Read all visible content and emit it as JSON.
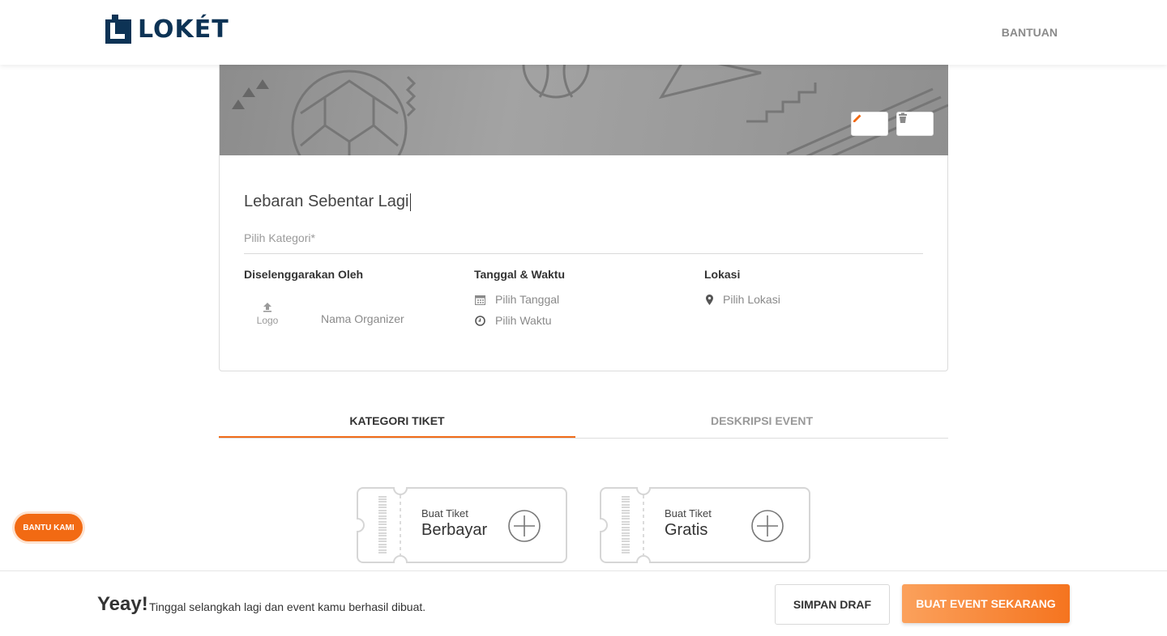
{
  "header": {
    "brand": "LOKÉT",
    "help_label": "BANTUAN"
  },
  "event": {
    "title": "Lebaran Sebentar Lagi",
    "category_placeholder": "Pilih Kategori*",
    "organizer": {
      "label": "Diselenggarakan Oleh",
      "logo_label": "Logo",
      "name_placeholder": "Nama Organizer"
    },
    "datetime": {
      "label": "Tanggal & Waktu",
      "date_placeholder": "Pilih Tanggal",
      "time_placeholder": "Pilih Waktu"
    },
    "location": {
      "label": "Lokasi",
      "placeholder": "Pilih Lokasi"
    }
  },
  "tabs": [
    {
      "label": "KATEGORI TIKET",
      "active": true
    },
    {
      "label": "DESKRIPSI EVENT",
      "active": false
    }
  ],
  "tickets": [
    {
      "small": "Buat Tiket",
      "big": "Berbayar"
    },
    {
      "small": "Buat Tiket",
      "big": "Gratis"
    }
  ],
  "floating_help": "BANTU KAMI",
  "footer": {
    "headline": "Yeay!",
    "message": "Tinggal selangkah lagi dan event kamu berhasil dibuat.",
    "draft_label": "SIMPAN DRAF",
    "create_label": "BUAT EVENT SEKARANG"
  },
  "colors": {
    "accent": "#f26a13",
    "brand": "#0d3355"
  },
  "icons": [
    "pencil-icon",
    "trash-icon",
    "upload-icon",
    "calendar-icon",
    "clock-icon",
    "map-pin-icon",
    "plus-circle-icon"
  ]
}
